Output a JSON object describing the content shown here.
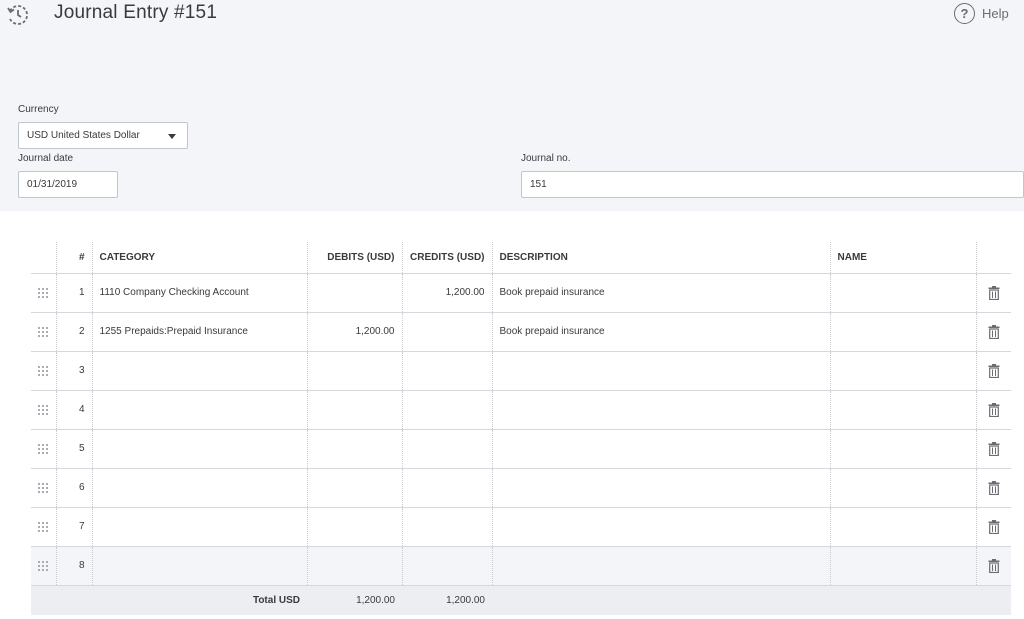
{
  "header": {
    "title": "Journal Entry  #151",
    "help_label": "Help"
  },
  "form": {
    "currency_label": "Currency",
    "currency_value": "USD United States Dollar",
    "journal_date_label": "Journal date",
    "journal_date_value": "01/31/2019",
    "journal_no_label": "Journal no.",
    "journal_no_value": "151"
  },
  "table": {
    "headers": {
      "number": "#",
      "category": "CATEGORY",
      "debits": "DEBITS (USD)",
      "credits": "CREDITS (USD)",
      "description": "DESCRIPTION",
      "name": "NAME"
    },
    "rows": [
      {
        "number": "1",
        "category": "1110 Company Checking Account",
        "debit": "",
        "credit": "1,200.00",
        "description": "Book prepaid insurance",
        "name": ""
      },
      {
        "number": "2",
        "category": "1255 Prepaids:Prepaid Insurance",
        "debit": "1,200.00",
        "credit": "",
        "description": "Book prepaid insurance",
        "name": ""
      },
      {
        "number": "3",
        "category": "",
        "debit": "",
        "credit": "",
        "description": "",
        "name": ""
      },
      {
        "number": "4",
        "category": "",
        "debit": "",
        "credit": "",
        "description": "",
        "name": ""
      },
      {
        "number": "5",
        "category": "",
        "debit": "",
        "credit": "",
        "description": "",
        "name": ""
      },
      {
        "number": "6",
        "category": "",
        "debit": "",
        "credit": "",
        "description": "",
        "name": ""
      },
      {
        "number": "7",
        "category": "",
        "debit": "",
        "credit": "",
        "description": "",
        "name": ""
      },
      {
        "number": "8",
        "category": "",
        "debit": "",
        "credit": "",
        "description": "",
        "name": ""
      }
    ],
    "total": {
      "label": "Total USD",
      "debit": "1,200.00",
      "credit": "1,200.00"
    }
  }
}
